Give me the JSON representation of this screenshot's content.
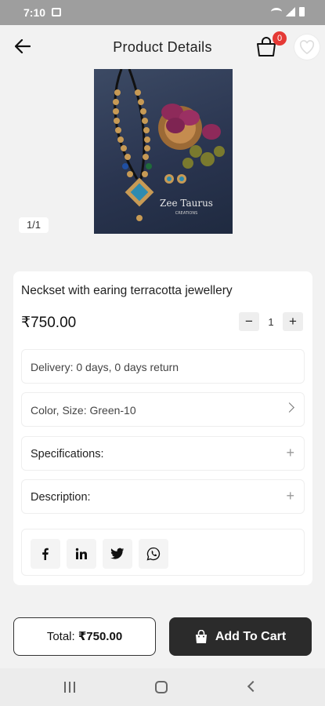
{
  "status": {
    "time": "7:10"
  },
  "header": {
    "title": "Product Details",
    "back_icon": "arrow-left-icon",
    "cart_icon": "shopping-bag-icon",
    "cart_count": "0",
    "favorite_icon": "heart-icon"
  },
  "gallery": {
    "counter": "1/1",
    "image_brand_text": "Zee Taurus",
    "image_brand_sub": "CREATIONS"
  },
  "product": {
    "name": "Neckset with earing terracotta jewellery",
    "price": "₹750.00",
    "quantity": "1",
    "decrement_label": "−",
    "increment_label": "+"
  },
  "details": {
    "delivery_label": "Delivery:",
    "delivery_value": "0 days, 0 days return",
    "variant_label": "Color, Size:",
    "variant_value": "Green-10",
    "specifications_label": "Specifications:",
    "description_label": "Description:",
    "expand_symbol": "+"
  },
  "share": {
    "icons": [
      "facebook-icon",
      "linkedin-icon",
      "twitter-icon",
      "whatsapp-icon"
    ]
  },
  "footer": {
    "total_label": "Total:",
    "total_value": "₹750.00",
    "add_to_cart_label": "Add To Cart"
  },
  "colors": {
    "accent_dark": "#2b2b2b",
    "badge": "#e53935",
    "background": "#f2f2f2"
  }
}
